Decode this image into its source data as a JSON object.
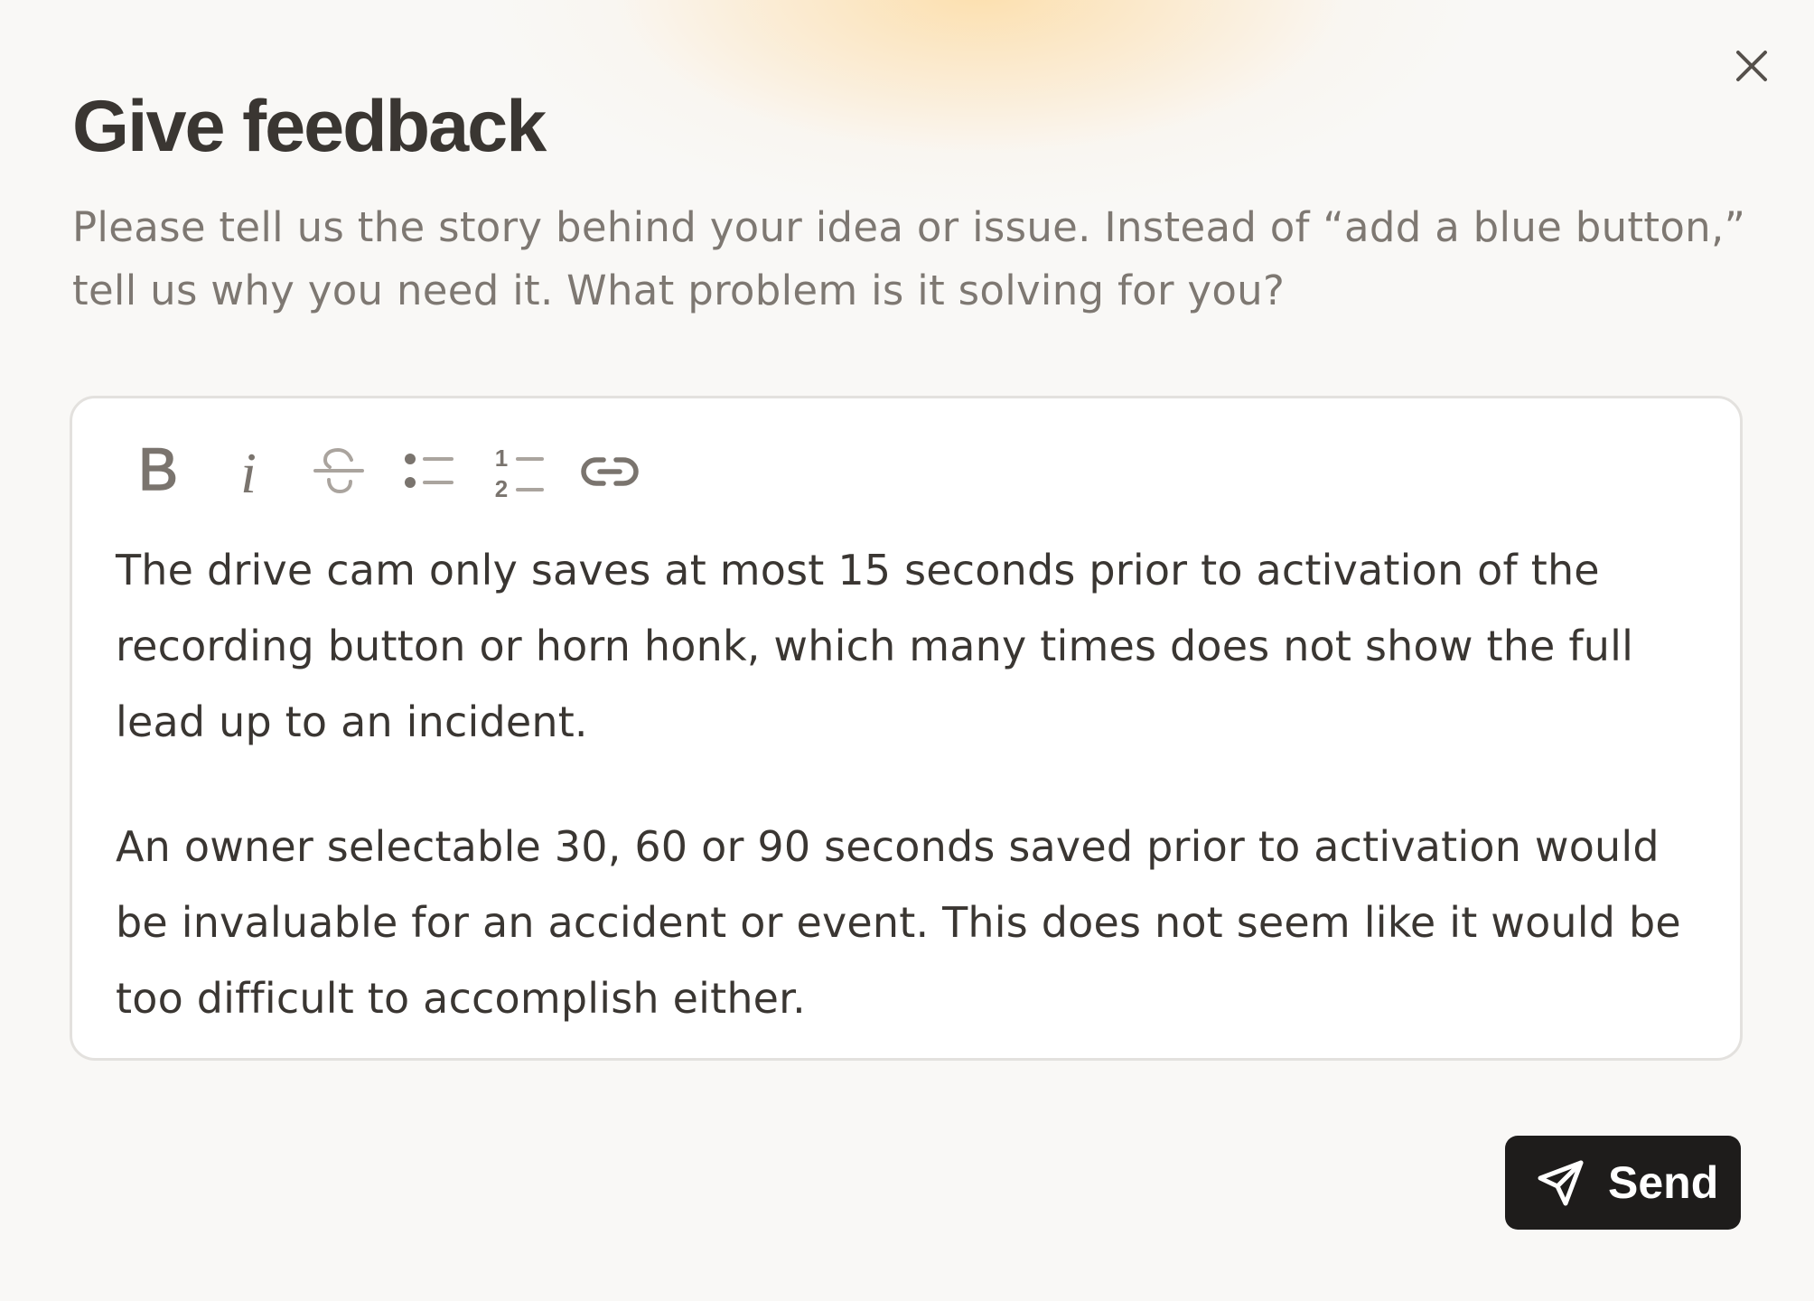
{
  "dialog": {
    "title": "Give feedback",
    "subtitle": "Please tell us the story behind your idea or issue. Instead of “add a blue button,” tell us why you need it. What problem is it solving for you?",
    "close_icon": "close-icon"
  },
  "toolbar": {
    "items": [
      {
        "name": "bold",
        "icon": "bold-icon",
        "glyph": "B"
      },
      {
        "name": "italic",
        "icon": "italic-icon",
        "glyph": "i"
      },
      {
        "name": "strikethrough",
        "icon": "strikethrough-icon"
      },
      {
        "name": "bulleted-list",
        "icon": "bulleted-list-icon"
      },
      {
        "name": "numbered-list",
        "icon": "numbered-list-icon",
        "glyphs": [
          "1",
          "2"
        ]
      },
      {
        "name": "link",
        "icon": "link-icon"
      }
    ]
  },
  "editor": {
    "paragraphs": [
      "The drive cam only saves at most 15 seconds prior to activation of the recording button or horn honk, which many times does not show the full lead up to an incident.",
      "An owner selectable 30, 60 or 90 seconds saved prior to activation would be invaluable for an accident or event. This does not seem like it would be too difficult to accomplish either."
    ]
  },
  "actions": {
    "send_label": "Send",
    "send_icon": "paper-plane-icon"
  },
  "colors": {
    "title_text": "#3a3632",
    "subtitle_text": "#7e7872",
    "body_text": "#3a3632",
    "icon": "#7a746e",
    "send_button_bg": "#1e1c1b",
    "send_button_text": "#ffffff",
    "editor_border": "#e3e1de",
    "glow": "#fcdeaa"
  }
}
